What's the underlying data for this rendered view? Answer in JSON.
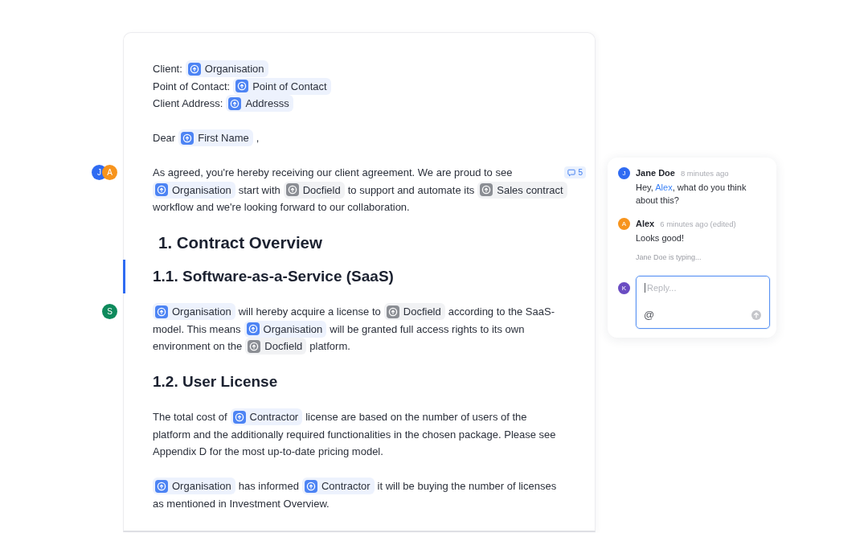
{
  "document": {
    "blocks": [
      {
        "kind": "paragraph",
        "active": false,
        "lines": [
          [
            {
              "kind": "text",
              "text": "Client:"
            },
            {
              "kind": "variable",
              "text": "Organisation"
            }
          ],
          [
            {
              "kind": "text",
              "text": "Point of Contact:"
            },
            {
              "kind": "variable",
              "text": "Point of Contact"
            }
          ],
          [
            {
              "kind": "text",
              "text": "Client Address:"
            },
            {
              "kind": "variable",
              "text": "Addresss"
            }
          ]
        ]
      },
      {
        "kind": "paragraph",
        "active": false,
        "lines": [
          [
            {
              "kind": "text",
              "text": "Dear"
            },
            {
              "kind": "variable",
              "text": "First Name"
            },
            {
              "kind": "text",
              "text": ","
            }
          ]
        ]
      },
      {
        "kind": "paragraph",
        "active": false,
        "avatars": [
          {
            "initial": "J",
            "color": "#2f6bf2"
          },
          {
            "initial": "A",
            "color": "#f7941d"
          }
        ],
        "comment_count": "5",
        "lines": [
          [
            {
              "kind": "text",
              "text": "As agreed, you're hereby receiving our client agreement. We are proud to see"
            }
          ],
          [
            {
              "kind": "variable",
              "text": "Organisation"
            },
            {
              "kind": "text",
              "text": "start with"
            },
            {
              "kind": "fixed",
              "text": "Docfield"
            },
            {
              "kind": "text",
              "text": "to support and automate its"
            },
            {
              "kind": "fixed",
              "text": "Sales contract"
            }
          ],
          [
            {
              "kind": "text",
              "text": "workflow and we're looking forward to our collaboration."
            }
          ]
        ]
      },
      {
        "kind": "heading1",
        "active": false,
        "text": "1. Contract Overview"
      },
      {
        "kind": "heading2",
        "active": true,
        "text": "1.1. Software-as-a-Service (SaaS)"
      },
      {
        "kind": "paragraph",
        "active": false,
        "avatars": [
          {
            "initial": "S",
            "color": "#0e8a5c"
          }
        ],
        "lines": [
          [
            {
              "kind": "variable",
              "text": "Organisation"
            },
            {
              "kind": "text",
              "text": "will hereby acquire a license to"
            },
            {
              "kind": "fixed",
              "text": "Docfield"
            },
            {
              "kind": "text",
              "text": "according to the SaaS-"
            }
          ],
          [
            {
              "kind": "text",
              "text": "model. This means"
            },
            {
              "kind": "variable",
              "text": "Organisation"
            },
            {
              "kind": "text",
              "text": "will be granted full access rights to its own"
            }
          ],
          [
            {
              "kind": "text",
              "text": "environment on the"
            },
            {
              "kind": "fixed",
              "text": "Docfield"
            },
            {
              "kind": "text",
              "text": "platform."
            }
          ]
        ]
      },
      {
        "kind": "heading2",
        "active": false,
        "text": "1.2. User License"
      },
      {
        "kind": "paragraph",
        "active": false,
        "lines": [
          [
            {
              "kind": "text",
              "text": "The total cost of"
            },
            {
              "kind": "variable",
              "text": "Contractor"
            },
            {
              "kind": "text",
              "text": "license are based on the number of users of the"
            }
          ],
          [
            {
              "kind": "text",
              "text": "platform and the additionally required functionalities in the chosen package. Please see"
            }
          ],
          [
            {
              "kind": "text",
              "text": "Appendix D for the most up-to-date pricing model."
            }
          ]
        ]
      },
      {
        "kind": "paragraph",
        "active": false,
        "lines": [
          [
            {
              "kind": "variable",
              "text": "Organisation"
            },
            {
              "kind": "text",
              "text": "has informed"
            },
            {
              "kind": "variable",
              "text": "Contractor"
            },
            {
              "kind": "text",
              "text": "it will be buying the number of licenses"
            }
          ],
          [
            {
              "kind": "text",
              "text": "as mentioned in Investment Overview."
            }
          ]
        ]
      }
    ]
  },
  "comment_thread": {
    "comments": [
      {
        "author": "Jane Doe",
        "initial": "J",
        "color": "#2f6bf2",
        "time": "8 minutes ago",
        "body": [
          {
            "kind": "text",
            "text": "Hey, "
          },
          {
            "kind": "mention",
            "text": "Alex"
          },
          {
            "kind": "text",
            "text": ", what do you think about this?"
          }
        ]
      },
      {
        "author": "Alex",
        "initial": "A",
        "color": "#f7941d",
        "time": "6 minutes ago (edited)",
        "body": [
          {
            "kind": "text",
            "text": "Looks good!"
          }
        ]
      }
    ],
    "typing": "Jane Doe is typing...",
    "reply": {
      "initial": "K",
      "color": "#6a4cc2",
      "placeholder": "Reply...",
      "focused": true,
      "mention_button": "@",
      "send_disabled": true
    }
  }
}
